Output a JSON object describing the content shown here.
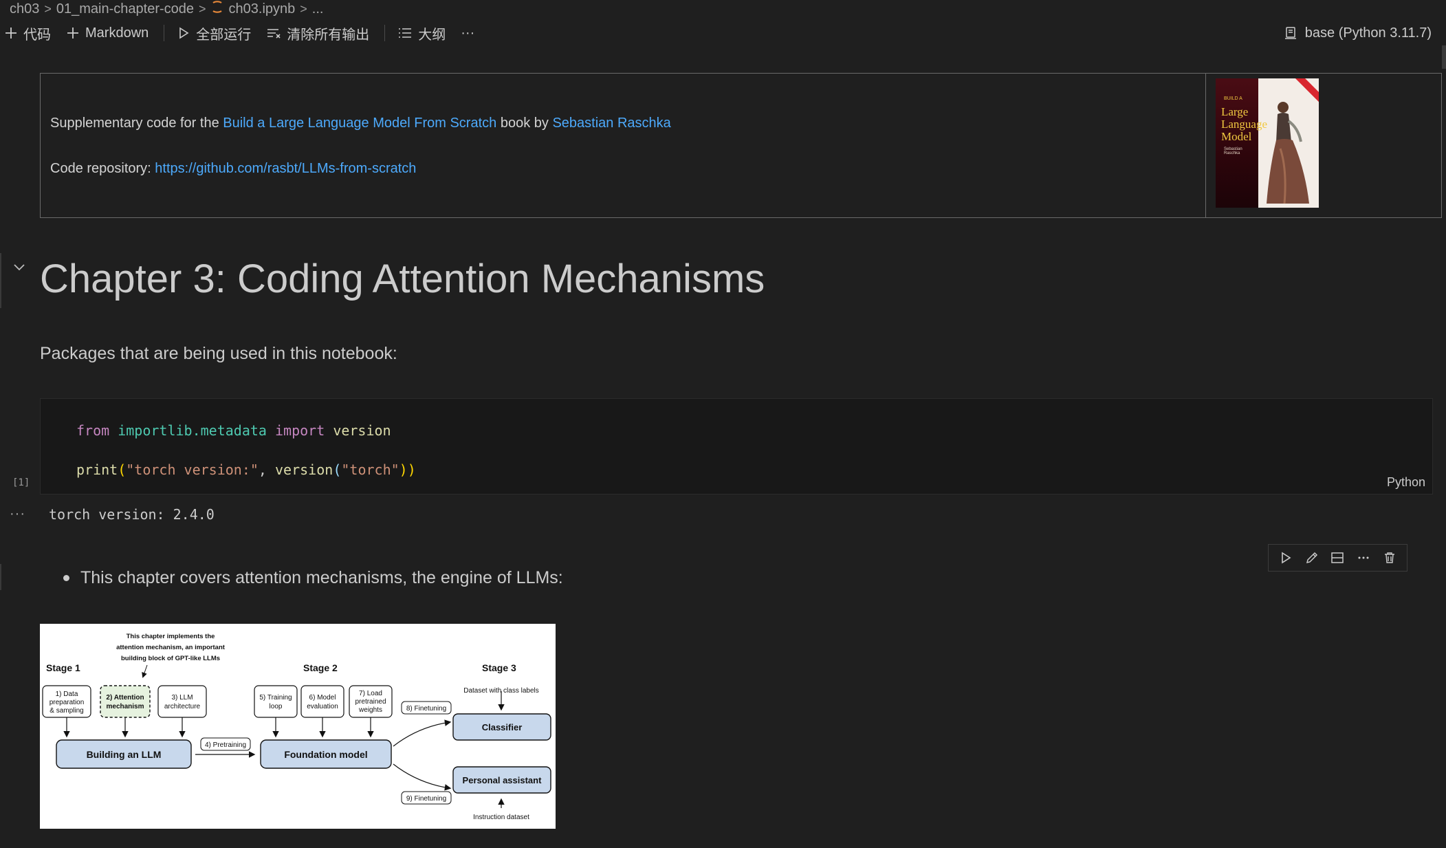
{
  "breadcrumb": {
    "items": [
      "ch03",
      "01_main-chapter-code",
      "ch03.ipynb",
      "..."
    ],
    "separator": ">"
  },
  "toolbar": {
    "code_label": "代码",
    "markdown_label": "Markdown",
    "run_all_label": "全部运行",
    "clear_outputs_label": "清除所有输出",
    "outline_label": "大纲",
    "more_label": "···",
    "kernel_label": "base (Python 3.11.7)"
  },
  "header_cell": {
    "line1_prefix": "Supplementary code for the ",
    "book_link": "Build a Large Language Model From Scratch",
    "line1_mid": " book by ",
    "author_link": "Sebastian Raschka",
    "line2_prefix": "Code repository: ",
    "repo_link": "https://github.com/rasbt/LLMs-from-scratch",
    "cover": {
      "small_text": "BUILD A",
      "title": "Large Language Model",
      "author": "Sebastian Raschka"
    }
  },
  "chapter_title": "Chapter 3: Coding Attention Mechanisms",
  "packages_text": "Packages that are being used in this notebook:",
  "code_cell": {
    "line1": {
      "kw1": "from",
      "module": "importlib.metadata",
      "kw2": "import",
      "name": "version"
    },
    "line2": {
      "fn": "print",
      "open": "(",
      "str1": "\"torch version:\"",
      "comma": ", ",
      "fn2": "version",
      "open2": "(",
      "str2": "\"torch\"",
      "close": "))"
    },
    "language": "Python",
    "execution_count": "[1]"
  },
  "output": {
    "dots": "···",
    "text": "torch version: 2.4.0"
  },
  "bullet_text": "This chapter covers attention mechanisms, the engine of LLMs:",
  "diagram": {
    "note": [
      "This chapter implements the",
      "attention mechanism, an important",
      "building block of GPT-like LLMs"
    ],
    "stage1": "Stage 1",
    "stage2": "Stage 2",
    "stage3": "Stage 3",
    "box1": [
      "1) Data",
      "preparation",
      "& sampling"
    ],
    "box2": [
      "2) Attention",
      "mechanism"
    ],
    "box3": [
      "3) LLM",
      "architecture"
    ],
    "box5": [
      "5) Training",
      "loop"
    ],
    "box6": [
      "6) Model",
      "evaluation"
    ],
    "box7": [
      "7) Load",
      "pretrained",
      "weights"
    ],
    "building": "Building an LLM",
    "pretraining": "4) Pretraining",
    "foundation": "Foundation model",
    "finetune8": "8) Finetuning",
    "finetune9": "9) Finetuning",
    "dataset_labels": "Dataset with class labels",
    "classifier": "Classifier",
    "assistant": "Personal assistant",
    "instruction": "Instruction dataset"
  }
}
